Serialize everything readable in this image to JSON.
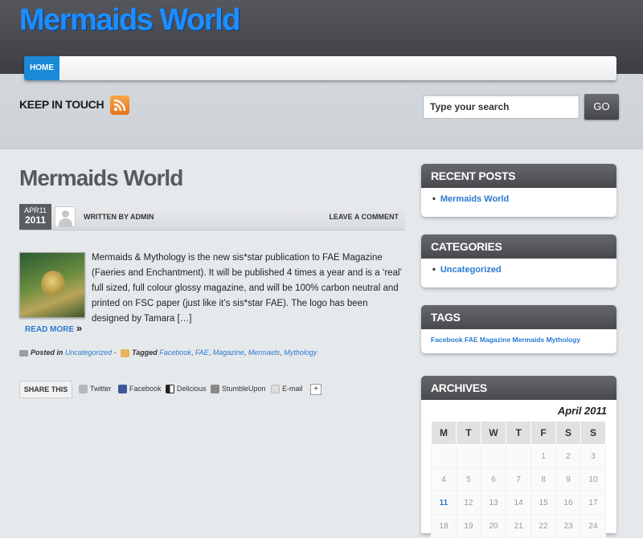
{
  "site": {
    "title": "Mermaids World"
  },
  "nav": {
    "items": [
      {
        "label": "HOME"
      }
    ]
  },
  "header": {
    "keep_in_touch": "KEEP IN TOUCH",
    "search_placeholder": "Type your search",
    "go_label": "GO"
  },
  "post": {
    "title": "Mermaids World",
    "date_month_day": "APR11",
    "date_year": "2011",
    "written_by": "WRITTEN BY ADMIN",
    "leave_comment": "LEAVE A COMMENT",
    "excerpt": "Mermaids & Mythology is the new sis*star publication to FAE Magazine (Faeries and Enchantment). It will be published 4 times a year and is a ‘real’ full sized, full colour glossy magazine, and will be 100% carbon neutral and printed on FSC paper (just like it’s sis*star FAE). The logo has been designed by Tamara […]",
    "read_more": "READ MORE",
    "posted_in_label": "Posted in",
    "category": "Uncategorized",
    "tagged_label": "Tagged",
    "tags": [
      "Facebook",
      "FAE",
      "Magazine",
      "Mermaids",
      "Mythology"
    ]
  },
  "share": {
    "label": "SHARE THIS",
    "items": [
      {
        "label": "Twitter",
        "icon": "twitter-icon",
        "color": "#b5b8bb"
      },
      {
        "label": "Facebook",
        "icon": "facebook-icon",
        "color": "#3b5998"
      },
      {
        "label": "Delicious",
        "icon": "delicious-icon",
        "color": "#222222"
      },
      {
        "label": "StumbleUpon",
        "icon": "stumbleupon-icon",
        "color": "#888888"
      },
      {
        "label": "E-mail",
        "icon": "email-icon",
        "color": "#cccccc"
      }
    ],
    "more": "+"
  },
  "sidebar": {
    "recent_posts": {
      "title": "RECENT POSTS",
      "items": [
        "Mermaids World"
      ]
    },
    "categories": {
      "title": "CATEGORIES",
      "items": [
        "Uncategorized"
      ]
    },
    "tags": {
      "title": "TAGS",
      "text": "Facebook FAE Magazine Mermaids Mythology"
    },
    "archives": {
      "title": "ARCHIVES",
      "month": "April 2011",
      "weekdays": [
        "M",
        "T",
        "W",
        "T",
        "F",
        "S",
        "S"
      ],
      "weeks": [
        [
          "",
          "",
          "",
          "",
          "1",
          "2",
          "3"
        ],
        [
          "4",
          "5",
          "6",
          "7",
          "8",
          "9",
          "10"
        ],
        [
          "11",
          "12",
          "13",
          "14",
          "15",
          "16",
          "17"
        ],
        [
          "18",
          "19",
          "20",
          "21",
          "22",
          "23",
          "24"
        ]
      ],
      "highlighted_day": "11"
    }
  },
  "colors": {
    "brand": "#1d8eff",
    "link": "#2a7ad0",
    "nav_active": "#1a8ad8"
  }
}
